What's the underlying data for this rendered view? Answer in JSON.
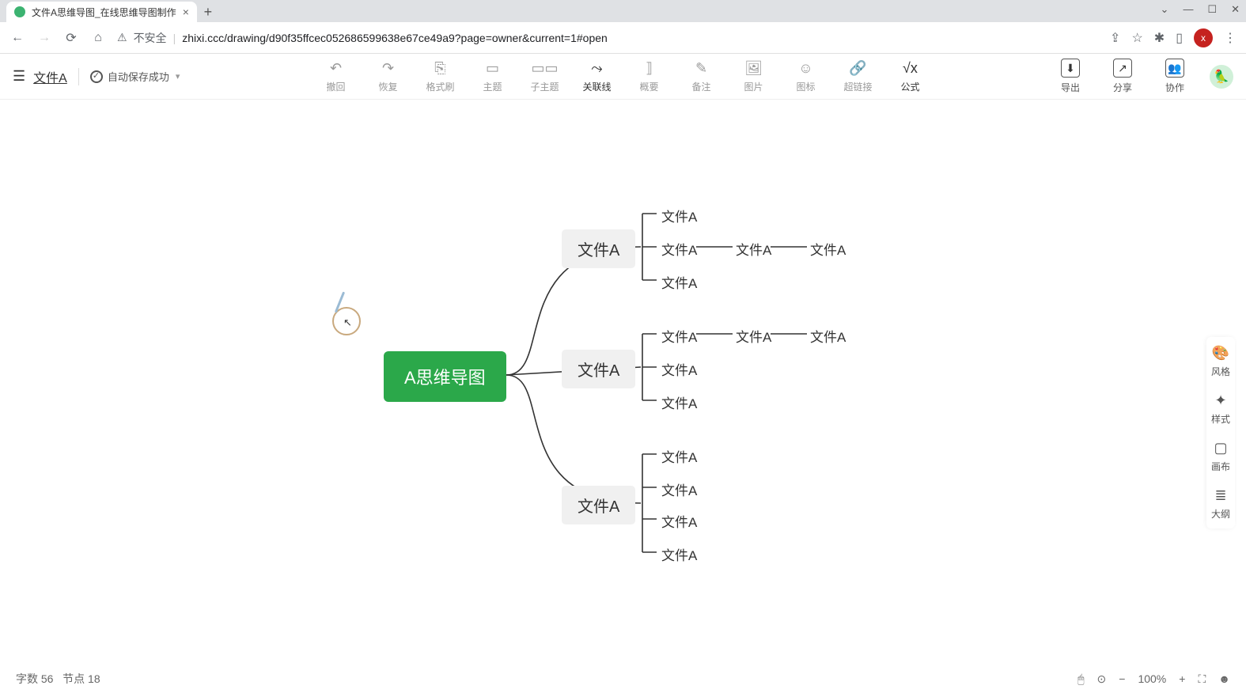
{
  "browser": {
    "tab_title": "文件A思维导图_在线思维导图制作",
    "not_secure": "不安全",
    "url": "zhixi.ccc/drawing/d90f35ffcec052686599638e67ce49a9?page=owner&current=1#open",
    "profile_letter": "x"
  },
  "app": {
    "file_name": "文件A",
    "autosave": "自动保存成功"
  },
  "toolbar": [
    {
      "label": "撤回",
      "icon": "↶",
      "active": false
    },
    {
      "label": "恢复",
      "icon": "↷",
      "active": false
    },
    {
      "label": "格式刷",
      "icon": "⎘",
      "active": false
    },
    {
      "label": "主题",
      "icon": "▭",
      "active": false
    },
    {
      "label": "子主题",
      "icon": "▭▭",
      "active": false
    },
    {
      "label": "关联线",
      "icon": "⤳",
      "active": true
    },
    {
      "label": "概要",
      "icon": "⟧",
      "active": false
    },
    {
      "label": "备注",
      "icon": "✎",
      "active": false
    },
    {
      "label": "图片",
      "icon": "🖼",
      "active": false
    },
    {
      "label": "图标",
      "icon": "☺",
      "active": false
    },
    {
      "label": "超链接",
      "icon": "🔗",
      "active": false
    },
    {
      "label": "公式",
      "icon": "√x",
      "active": true
    }
  ],
  "right_buttons": [
    {
      "label": "导出",
      "icon": "⬇"
    },
    {
      "label": "分享",
      "icon": "↗"
    },
    {
      "label": "协作",
      "icon": "👥"
    }
  ],
  "side_panel": [
    {
      "label": "风格",
      "icon": "🎨"
    },
    {
      "label": "样式",
      "icon": "✦"
    },
    {
      "label": "画布",
      "icon": "▢"
    },
    {
      "label": "大纲",
      "icon": "≣"
    }
  ],
  "mindmap": {
    "root": "A思维导图",
    "branches": [
      {
        "label": "文件A",
        "children": [
          {
            "label": "文件A"
          },
          {
            "label": "文件A",
            "children": [
              {
                "label": "文件A",
                "children": [
                  {
                    "label": "文件A"
                  }
                ]
              }
            ]
          },
          {
            "label": "文件A"
          }
        ]
      },
      {
        "label": "文件A",
        "children": [
          {
            "label": "文件A",
            "children": [
              {
                "label": "文件A",
                "children": [
                  {
                    "label": "文件A"
                  }
                ]
              }
            ]
          },
          {
            "label": "文件A"
          },
          {
            "label": "文件A"
          }
        ]
      },
      {
        "label": "文件A",
        "children": [
          {
            "label": "文件A"
          },
          {
            "label": "文件A"
          },
          {
            "label": "文件A"
          },
          {
            "label": "文件A"
          }
        ]
      }
    ]
  },
  "status": {
    "word_count_label": "字数",
    "word_count": "56",
    "node_count_label": "节点",
    "node_count": "18",
    "zoom": "100%"
  }
}
